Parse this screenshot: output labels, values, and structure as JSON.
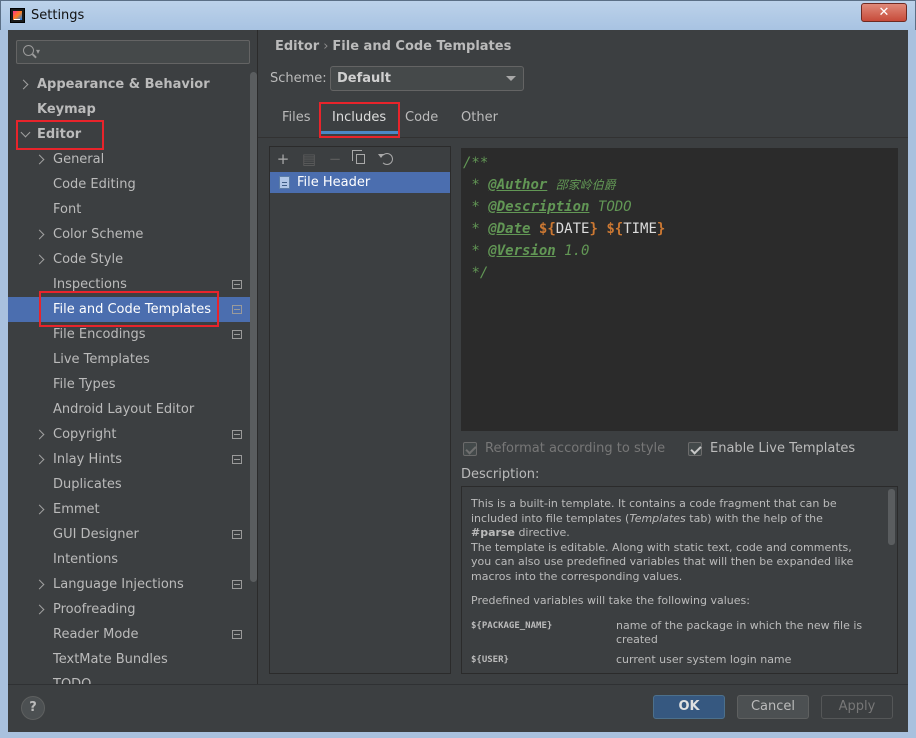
{
  "window": {
    "title": "Settings",
    "close_glyph": "✕"
  },
  "sidebar": {
    "search_placeholder": "",
    "items": [
      {
        "label": "Appearance & Behavior",
        "level": 0,
        "chevron": "right",
        "bold": true
      },
      {
        "label": "Keymap",
        "level": 0,
        "chevron": "none",
        "bold": true
      },
      {
        "label": "Editor",
        "level": 0,
        "chevron": "down",
        "bold": true
      },
      {
        "label": "General",
        "level": 1,
        "chevron": "right"
      },
      {
        "label": "Code Editing",
        "level": 1,
        "chevron": "none"
      },
      {
        "label": "Font",
        "level": 1,
        "chevron": "none"
      },
      {
        "label": "Color Scheme",
        "level": 1,
        "chevron": "right"
      },
      {
        "label": "Code Style",
        "level": 1,
        "chevron": "right"
      },
      {
        "label": "Inspections",
        "level": 1,
        "chevron": "none",
        "project_icon": true
      },
      {
        "label": "File and Code Templates",
        "level": 1,
        "chevron": "none",
        "project_icon": true,
        "selected": true
      },
      {
        "label": "File Encodings",
        "level": 1,
        "chevron": "none",
        "project_icon": true
      },
      {
        "label": "Live Templates",
        "level": 1,
        "chevron": "none"
      },
      {
        "label": "File Types",
        "level": 1,
        "chevron": "none"
      },
      {
        "label": "Android Layout Editor",
        "level": 1,
        "chevron": "none"
      },
      {
        "label": "Copyright",
        "level": 1,
        "chevron": "right",
        "project_icon": true
      },
      {
        "label": "Inlay Hints",
        "level": 1,
        "chevron": "right",
        "project_icon": true
      },
      {
        "label": "Duplicates",
        "level": 1,
        "chevron": "none"
      },
      {
        "label": "Emmet",
        "level": 1,
        "chevron": "right"
      },
      {
        "label": "GUI Designer",
        "level": 1,
        "chevron": "none",
        "project_icon": true
      },
      {
        "label": "Intentions",
        "level": 1,
        "chevron": "none"
      },
      {
        "label": "Language Injections",
        "level": 1,
        "chevron": "right",
        "project_icon": true
      },
      {
        "label": "Proofreading",
        "level": 1,
        "chevron": "right"
      },
      {
        "label": "Reader Mode",
        "level": 1,
        "chevron": "none",
        "project_icon": true
      },
      {
        "label": "TextMate Bundles",
        "level": 1,
        "chevron": "none"
      },
      {
        "label": "TODO",
        "level": 1,
        "chevron": "none"
      }
    ]
  },
  "breadcrumb": {
    "parent": "Editor",
    "current": "File and Code Templates"
  },
  "scheme": {
    "label": "Scheme:",
    "value": "Default"
  },
  "tabs": [
    {
      "label": "Files",
      "active": false
    },
    {
      "label": "Includes",
      "active": true
    },
    {
      "label": "Code",
      "active": false
    },
    {
      "label": "Other",
      "active": false
    }
  ],
  "template_list": {
    "items": [
      "File Header"
    ]
  },
  "editor": {
    "open": "/**",
    "author_tag": "@Author",
    "author_value": "邵家岭伯爵",
    "description_tag": "@Description",
    "description_value": "TODO",
    "date_tag": "@Date",
    "date_var": "DATE",
    "time_var": "TIME",
    "version_tag": "@Version",
    "version_value": "1.0",
    "close": "*/"
  },
  "options": {
    "reformat_label": "Reformat according to style",
    "live_templates_label": "Enable Live Templates"
  },
  "description": {
    "label": "Description:",
    "p1_a": "This is a built-in template. It contains a code fragment that can be included into file templates (",
    "p1_italic": "Templates",
    "p1_b": " tab) with the help of the ",
    "p1_bold": "#parse",
    "p1_c": " directive.",
    "p2": "The template is editable. Along with static text, code and comments, you can also use predefined variables that will then be expanded like macros into the corresponding values.",
    "p3": "Predefined variables will take the following values:",
    "vars": [
      {
        "name": "${PACKAGE_NAME}",
        "desc": "name of the package in which the new file is created"
      },
      {
        "name": "${USER}",
        "desc": "current user system login name"
      }
    ]
  },
  "buttons": {
    "help": "?",
    "ok": "OK",
    "cancel": "Cancel",
    "apply": "Apply"
  }
}
